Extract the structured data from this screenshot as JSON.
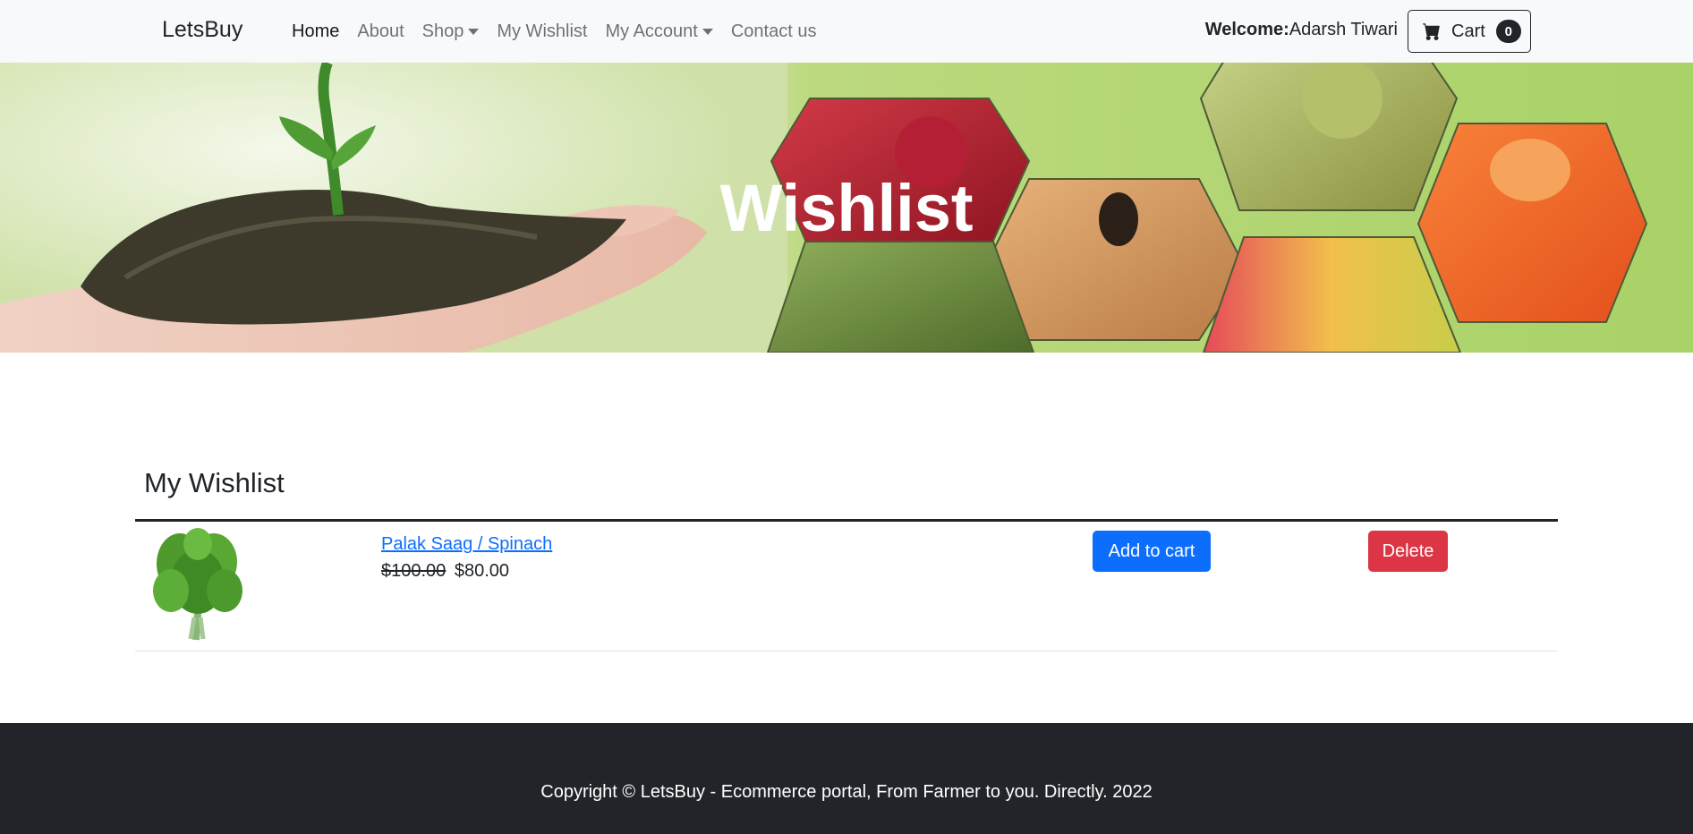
{
  "navbar": {
    "brand": "LetsBuy",
    "links": [
      {
        "label": "Home",
        "active": true,
        "dropdown": false
      },
      {
        "label": "About",
        "active": false,
        "dropdown": false
      },
      {
        "label": "Shop",
        "active": false,
        "dropdown": true
      },
      {
        "label": "My Wishlist",
        "active": false,
        "dropdown": false
      },
      {
        "label": "My Account",
        "active": false,
        "dropdown": true
      },
      {
        "label": "Contact us",
        "active": false,
        "dropdown": false
      }
    ],
    "welcome_label": "Welcome:",
    "welcome_user": "Adarsh Tiwari",
    "cart_label": "Cart",
    "cart_count": "0"
  },
  "banner": {
    "title": "Wishlist"
  },
  "wishlist": {
    "heading": "My Wishlist",
    "items": [
      {
        "name": "Palak Saag / Spinach",
        "old_price": "$100.00",
        "price": "$80.00",
        "add_to_cart_label": "Add to cart",
        "delete_label": "Delete"
      }
    ]
  },
  "footer": {
    "copyright": "Copyright © LetsBuy - Ecommerce portal, From Farmer to you. Directly. 2022"
  },
  "colors": {
    "primary": "#0d6efd",
    "danger": "#dc3545",
    "dark": "#212529",
    "navbar_bg": "#f8f9fa"
  },
  "icons": {
    "cart": "cart-icon",
    "dropdown": "chevron-down-icon"
  }
}
